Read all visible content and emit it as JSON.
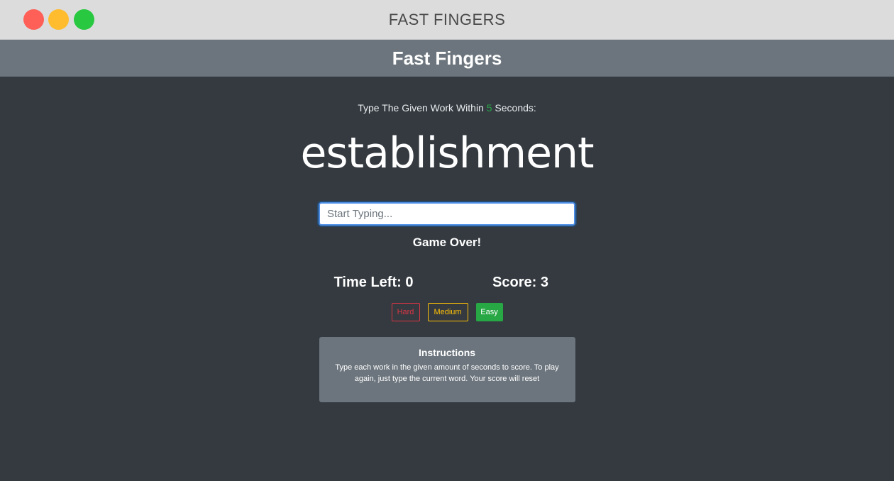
{
  "window": {
    "title": "FAST FINGERS",
    "controls": [
      "close",
      "minimize",
      "maximize"
    ]
  },
  "header": {
    "title": "Fast Fingers"
  },
  "prompt": {
    "before": "Type The Given Work Within ",
    "seconds": "5",
    "after": " Seconds:"
  },
  "current_word": "establishment",
  "input": {
    "value": "",
    "placeholder": "Start Typing..."
  },
  "status": "Game Over!",
  "stats": {
    "time_left": "Time Left: 0",
    "score": "Score: 3"
  },
  "difficulty": {
    "hard": "Hard",
    "medium": "Medium",
    "easy": "Easy",
    "selected": "Easy"
  },
  "instructions": {
    "title": "Instructions",
    "body": "Type each work in the given amount of seconds to score. To play again, just type the current word. Your score will reset"
  },
  "colors": {
    "background": "#343a40",
    "navbar": "#6c757d",
    "hard": "#dc3545",
    "medium": "#ffc107",
    "easy": "#28a745"
  }
}
